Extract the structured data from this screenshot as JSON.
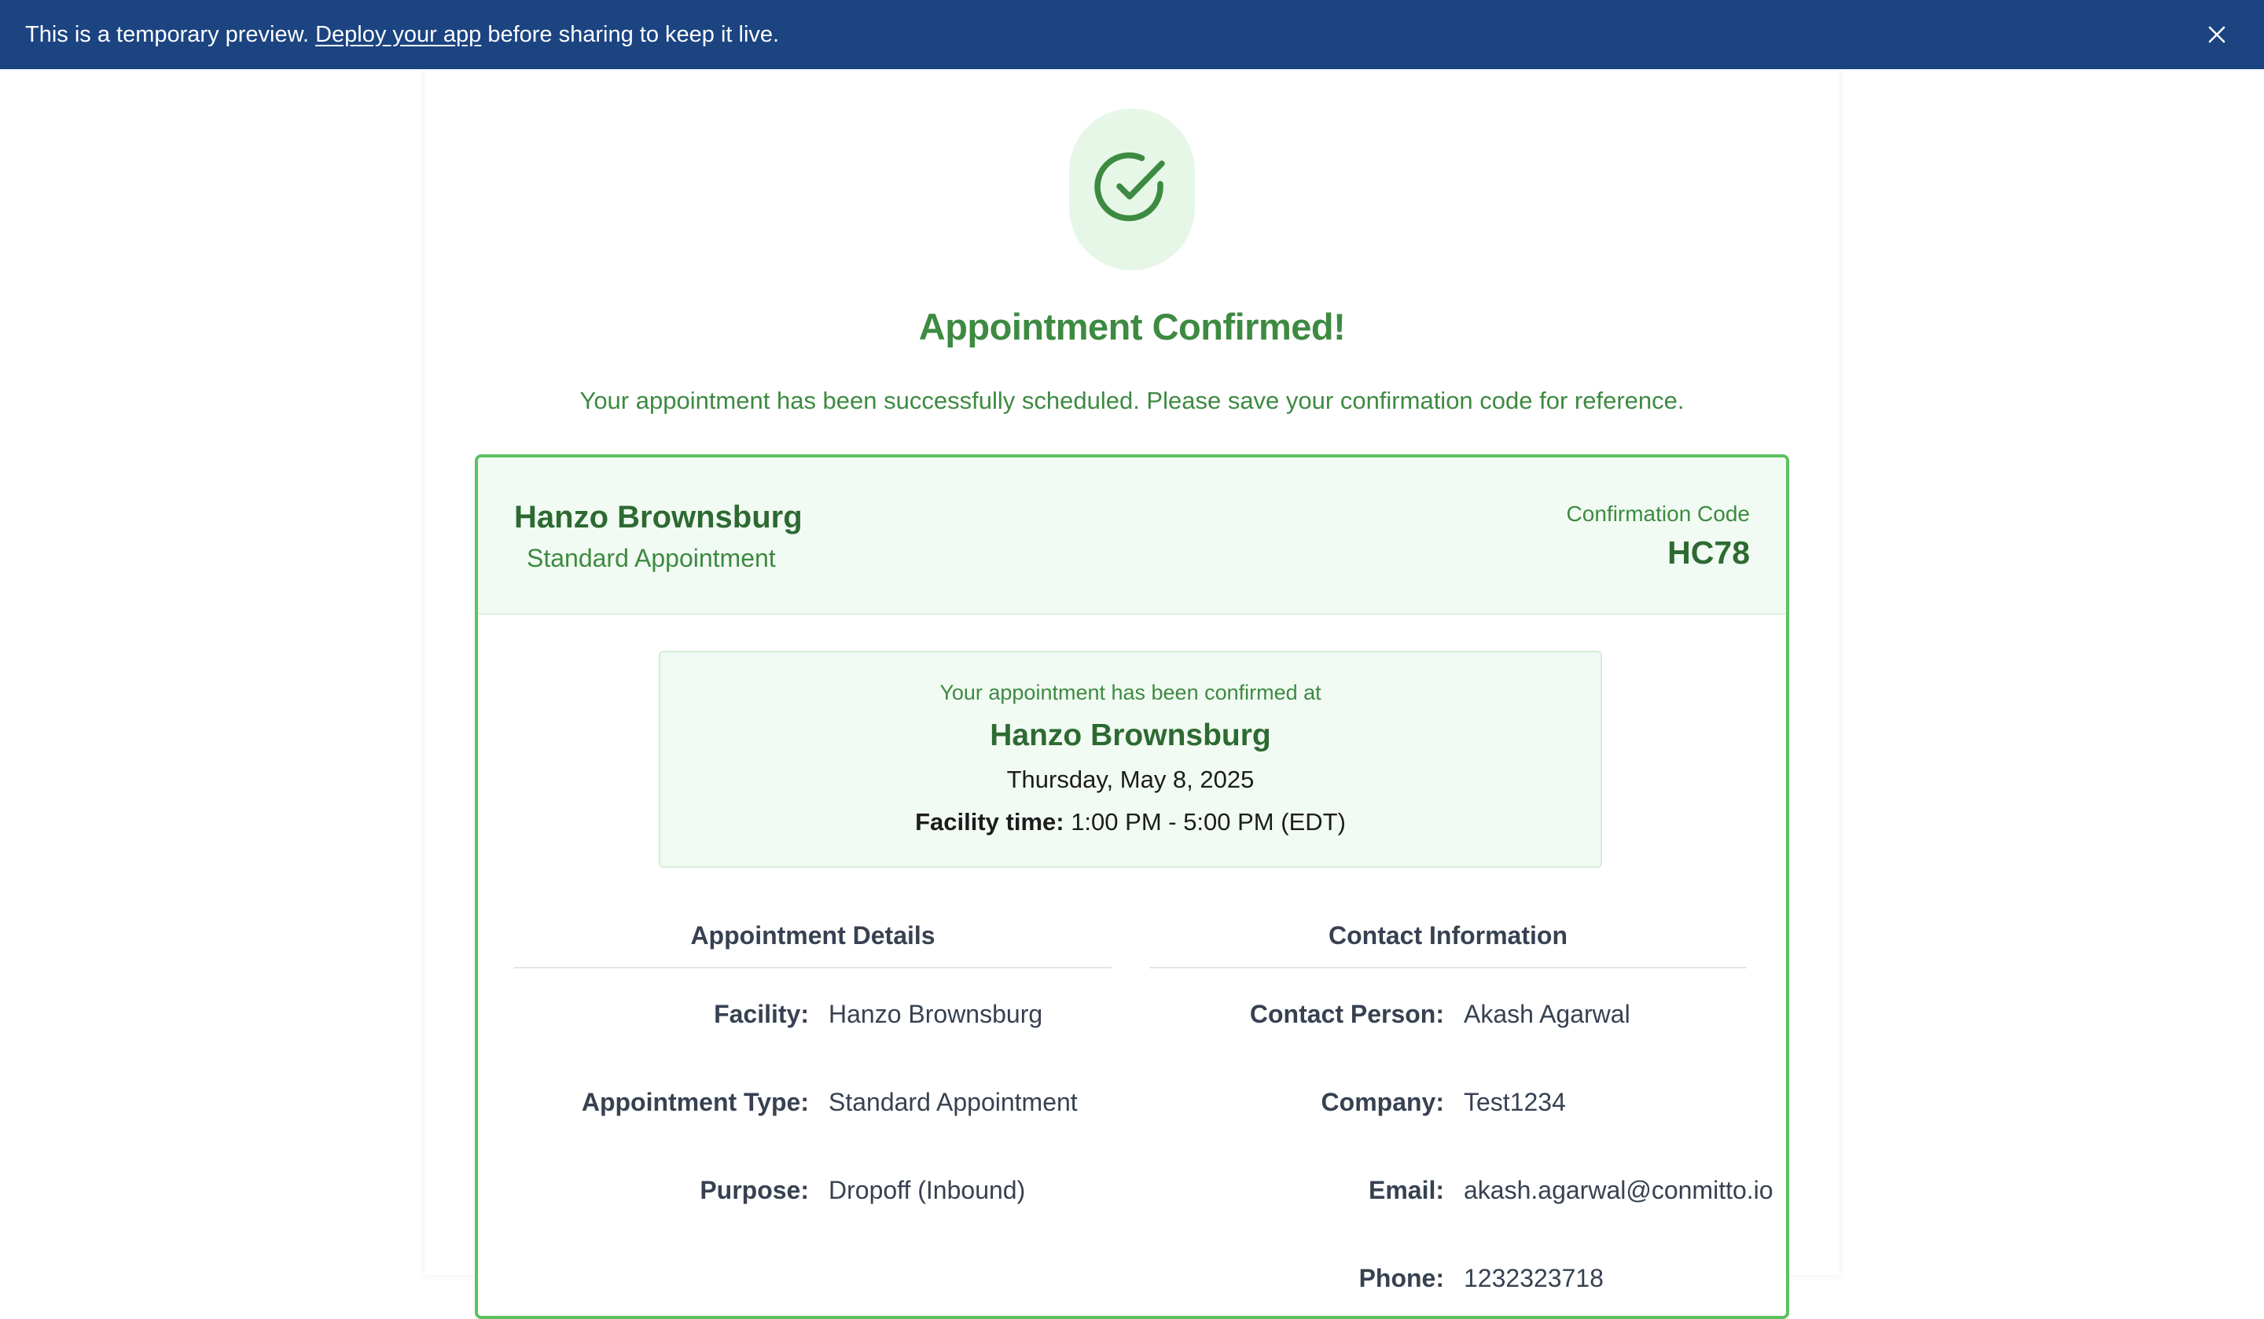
{
  "banner": {
    "text_before": "This is a temporary preview. ",
    "link_text": "Deploy your app",
    "text_after": " before sharing to keep it live.",
    "close_icon": "close-icon"
  },
  "header": {
    "success_icon": "check-circle-icon",
    "title": "Appointment Confirmed!",
    "subtitle": "Your appointment has been successfully scheduled. Please save your confirmation code for reference."
  },
  "card": {
    "facility_name": "Hanzo Brownsburg",
    "appointment_type": "Standard Appointment",
    "confirmation_label": "Confirmation Code",
    "confirmation_code": "HC78"
  },
  "confirmed_at": {
    "label": "Your appointment has been confirmed at",
    "facility": "Hanzo Brownsburg",
    "date": "Thursday, May 8, 2025",
    "time_label": "Facility time:",
    "time_value": " 1:00 PM - 5:00 PM (EDT)"
  },
  "appointment_details": {
    "title": "Appointment Details",
    "rows": [
      {
        "label": "Facility:",
        "value": "Hanzo Brownsburg"
      },
      {
        "label": "Appointment Type:",
        "value": "Standard Appointment"
      },
      {
        "label": "Purpose:",
        "value": "Dropoff (Inbound)"
      }
    ]
  },
  "contact_information": {
    "title": "Contact Information",
    "rows": [
      {
        "label": "Contact Person:",
        "value": "Akash Agarwal"
      },
      {
        "label": "Company:",
        "value": "Test1234"
      },
      {
        "label": "Email:",
        "value": "akash.agarwal@conmitto.io"
      },
      {
        "label": "Phone:",
        "value": "1232323718"
      }
    ]
  },
  "colors": {
    "banner_bg": "#1b4481",
    "success_green": "#3d8a41",
    "dark_green": "#2d6a32",
    "card_border": "#5cc160",
    "light_green_bg": "#f2fbf3"
  }
}
